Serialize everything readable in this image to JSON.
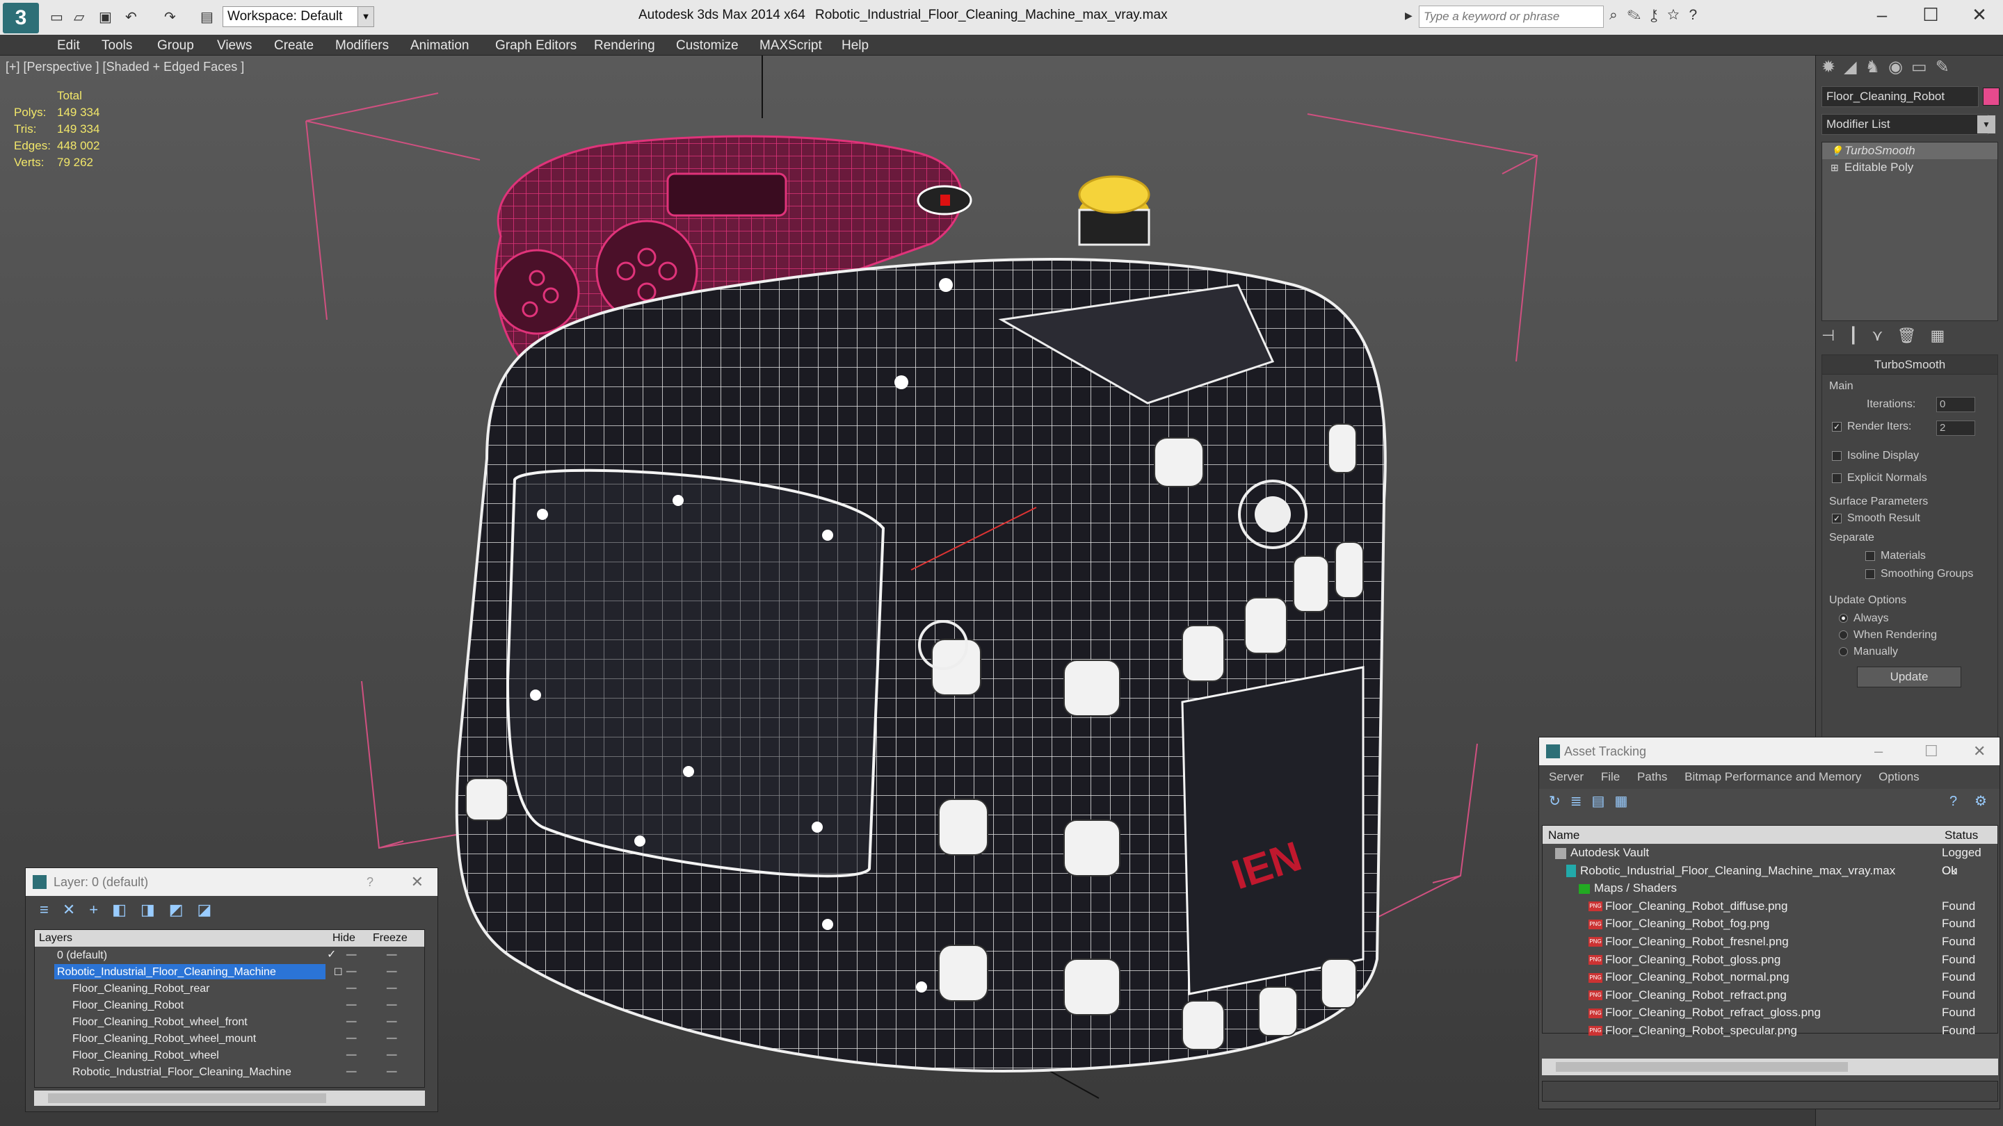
{
  "titlebar": {
    "logo": "3",
    "workspace": "Workspace: Default",
    "app_name": "Autodesk 3ds Max  2014 x64",
    "file_name": "Robotic_Industrial_Floor_Cleaning_Machine_max_vray.max",
    "search_placeholder": "Type a keyword or phrase"
  },
  "menu": [
    "Edit",
    "Tools",
    "Group",
    "Views",
    "Create",
    "Modifiers",
    "Animation",
    "Graph Editors",
    "Rendering",
    "Customize",
    "MAXScript",
    "Help"
  ],
  "viewport": {
    "label": "[+] [Perspective ] [Shaded + Edged Faces ]",
    "stats": {
      "header": "Total",
      "polys_label": "Polys:",
      "polys": "149 334",
      "tris_label": "Tris:",
      "tris": "149 334",
      "edges_label": "Edges:",
      "edges": "448 002",
      "verts_label": "Verts:",
      "verts": "79 262"
    }
  },
  "command_panel": {
    "object_name": "Floor_Cleaning_Robot",
    "object_color": "#e64a8d",
    "modifier_list": "Modifier List",
    "stack": [
      "TurboSmooth",
      "Editable Poly"
    ],
    "rollout_title": "TurboSmooth",
    "main_label": "Main",
    "iterations_label": "Iterations:",
    "iterations": "0",
    "render_iters_label": "Render Iters:",
    "render_iters": "2",
    "isoline": "Isoline Display",
    "explicit_normals": "Explicit Normals",
    "surface_params": "Surface Parameters",
    "smooth_result": "Smooth Result",
    "separate": "Separate",
    "materials": "Materials",
    "smoothing_groups": "Smoothing Groups",
    "update_options": "Update Options",
    "always": "Always",
    "when_rendering": "When Rendering",
    "manually": "Manually",
    "update_button": "Update"
  },
  "layer_window": {
    "title": "Layer: 0 (default)",
    "help": "?",
    "headers": {
      "layers": "Layers",
      "hide": "Hide",
      "freeze": "Freeze"
    },
    "rows": [
      {
        "name": "0 (default)"
      },
      {
        "name": "Robotic_Industrial_Floor_Cleaning_Machine"
      },
      {
        "name": "Floor_Cleaning_Robot_rear"
      },
      {
        "name": "Floor_Cleaning_Robot"
      },
      {
        "name": "Floor_Cleaning_Robot_wheel_front"
      },
      {
        "name": "Floor_Cleaning_Robot_wheel_mount"
      },
      {
        "name": "Floor_Cleaning_Robot_wheel"
      },
      {
        "name": "Robotic_Industrial_Floor_Cleaning_Machine"
      }
    ]
  },
  "asset_window": {
    "title": "Asset Tracking",
    "menu": [
      "Server",
      "File",
      "Paths",
      "Bitmap Performance and Memory",
      "Options"
    ],
    "headers": {
      "name": "Name",
      "status": "Status"
    },
    "rows": [
      {
        "name": "Autodesk Vault",
        "status": "Logged Ou"
      },
      {
        "name": "Robotic_Industrial_Floor_Cleaning_Machine_max_vray.max",
        "status": "Ok"
      },
      {
        "name": "Maps / Shaders",
        "status": ""
      },
      {
        "name": "Floor_Cleaning_Robot_diffuse.png",
        "status": "Found"
      },
      {
        "name": "Floor_Cleaning_Robot_fog.png",
        "status": "Found"
      },
      {
        "name": "Floor_Cleaning_Robot_fresnel.png",
        "status": "Found"
      },
      {
        "name": "Floor_Cleaning_Robot_gloss.png",
        "status": "Found"
      },
      {
        "name": "Floor_Cleaning_Robot_normal.png",
        "status": "Found"
      },
      {
        "name": "Floor_Cleaning_Robot_refract.png",
        "status": "Found"
      },
      {
        "name": "Floor_Cleaning_Robot_refract_gloss.png",
        "status": "Found"
      },
      {
        "name": "Floor_Cleaning_Robot_specular.png",
        "status": "Found"
      }
    ]
  }
}
